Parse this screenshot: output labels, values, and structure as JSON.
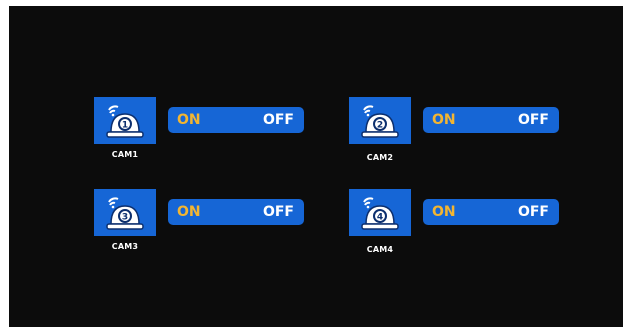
{
  "colors": {
    "screen_background": "#0c0c0c",
    "tile_blue": "#1666d6",
    "on_text": "#f2b532",
    "off_text": "#ffffff"
  },
  "cameras": [
    {
      "label": "CAM1",
      "number": "1",
      "icon": "dome-camera-wifi-icon",
      "on_label": "ON",
      "off_label": "OFF"
    },
    {
      "label": "CAM2",
      "number": "2",
      "icon": "dome-camera-wifi-icon",
      "on_label": "ON",
      "off_label": "OFF"
    },
    {
      "label": "CAM3",
      "number": "3",
      "icon": "dome-camera-wifi-icon",
      "on_label": "ON",
      "off_label": "OFF"
    },
    {
      "label": "CAM4",
      "number": "4",
      "icon": "dome-camera-wifi-icon",
      "on_label": "ON",
      "off_label": "OFF"
    }
  ]
}
